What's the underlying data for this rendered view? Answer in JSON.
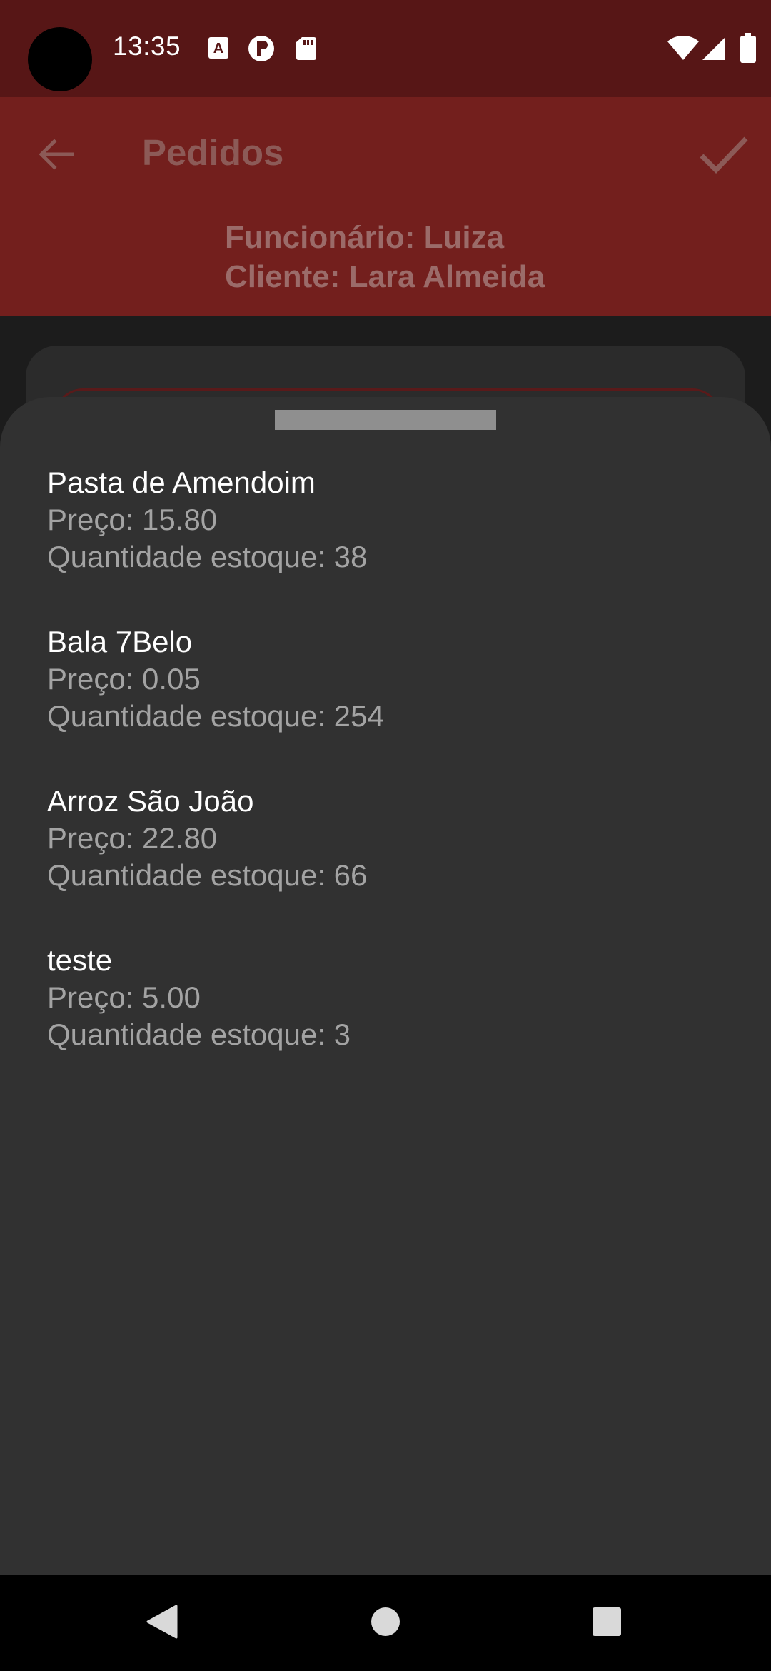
{
  "status_bar": {
    "time": "13:35",
    "icons_left": [
      "a-square-icon",
      "p-circle-icon",
      "sd-card-icon"
    ],
    "icons_right": [
      "wifi-icon",
      "signal-icon",
      "battery-icon"
    ]
  },
  "app_bar": {
    "title": "Pedidos",
    "employee": "Funcionário: Luiza",
    "client": "Cliente: Lara Almeida",
    "back_icon": "arrow-back-icon",
    "confirm_icon": "check-icon"
  },
  "products": [
    {
      "name": "Pasta de Amendoim",
      "price": "Preço: 15.80",
      "stock": "Quantidade estoque: 38"
    },
    {
      "name": "Bala 7Belo",
      "price": "Preço: 0.05",
      "stock": "Quantidade estoque: 254"
    },
    {
      "name": "Arroz São João",
      "price": "Preço: 22.80",
      "stock": "Quantidade estoque: 66"
    },
    {
      "name": "teste",
      "price": "Preço: 5.00",
      "stock": "Quantidade estoque: 3"
    }
  ],
  "colors": {
    "status_bar": "#571616",
    "app_bar": "#731f1d",
    "sheet": "#313131",
    "primary_text": "#ffffff",
    "secondary_text": "#a3a3a3"
  },
  "nav_bar": {
    "icons": [
      "nav-back-icon",
      "nav-home-icon",
      "nav-recents-icon"
    ]
  }
}
